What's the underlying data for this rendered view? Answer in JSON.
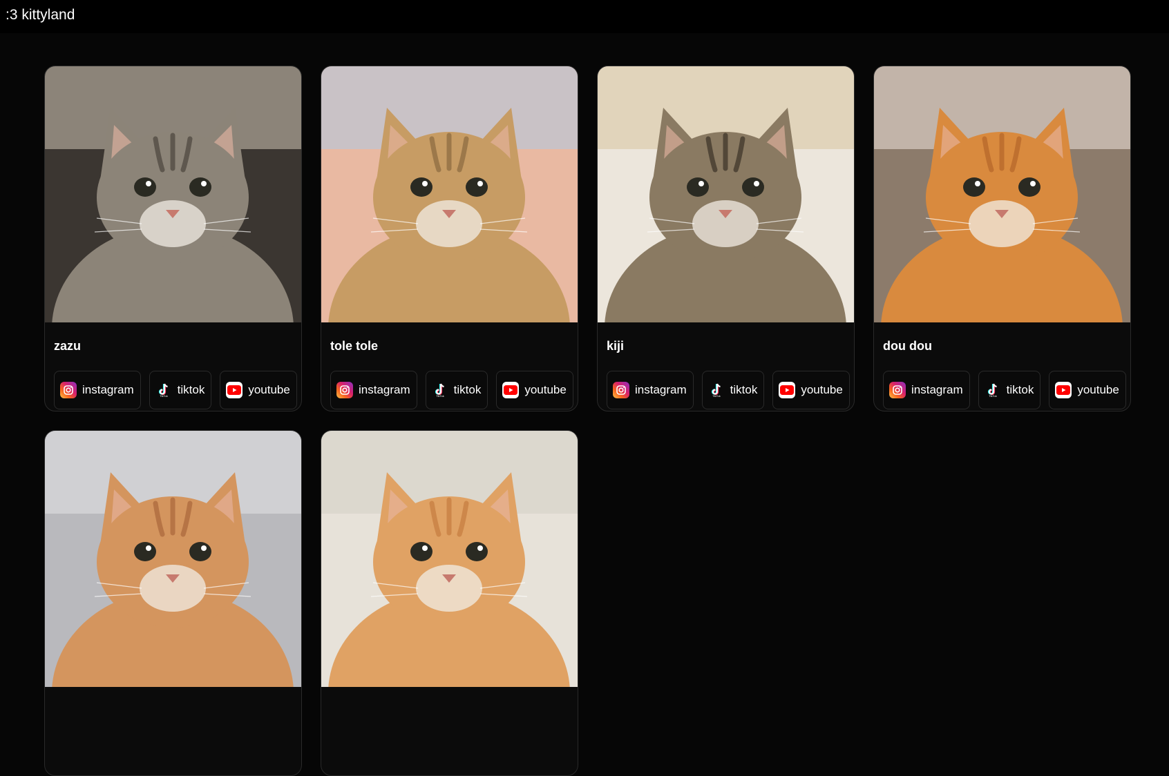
{
  "site": {
    "title": ":3 kittyland"
  },
  "cards": [
    {
      "name": "zazu",
      "photo": {
        "bg": "#3b3631",
        "fur": "#8c8478",
        "stripe": "#4a443c",
        "bg2": "#cfc5b4"
      },
      "links": [
        {
          "label": "instagram",
          "icon": "instagram-icon"
        },
        {
          "label": "tiktok",
          "icon": "tiktok-icon"
        },
        {
          "label": "youtube",
          "icon": "youtube-icon"
        }
      ]
    },
    {
      "name": "tole tole",
      "photo": {
        "bg": "#e9b9a2",
        "fur": "#c79c64",
        "stripe": "#8a6a3e",
        "bg2": "#aecbe3"
      },
      "links": [
        {
          "label": "instagram",
          "icon": "instagram-icon"
        },
        {
          "label": "tiktok",
          "icon": "tiktok-icon"
        },
        {
          "label": "youtube",
          "icon": "youtube-icon"
        }
      ]
    },
    {
      "name": "kiji",
      "photo": {
        "bg": "#ece6dc",
        "fur": "#8a7a62",
        "stripe": "#3a3226",
        "bg2": "#d9c4a0"
      },
      "links": [
        {
          "label": "instagram",
          "icon": "instagram-icon"
        },
        {
          "label": "tiktok",
          "icon": "tiktok-icon"
        },
        {
          "label": "youtube",
          "icon": "youtube-icon"
        }
      ]
    },
    {
      "name": "dou dou",
      "photo": {
        "bg": "#8c7b6b",
        "fur": "#d98a3e",
        "stripe": "#b3652a",
        "bg2": "#efe4dc"
      },
      "links": [
        {
          "label": "instagram",
          "icon": "instagram-icon"
        },
        {
          "label": "tiktok",
          "icon": "tiktok-icon"
        },
        {
          "label": "youtube",
          "icon": "youtube-icon"
        }
      ]
    },
    {
      "name": "",
      "photo": {
        "bg": "#b9b9bd",
        "fur": "#d4955e",
        "stripe": "#a9663a",
        "bg2": "#e3e3e6"
      },
      "links": []
    },
    {
      "name": "",
      "photo": {
        "bg": "#e7e2d9",
        "fur": "#e0a264",
        "stripe": "#c47c3e",
        "bg2": "#d4cfc5"
      },
      "links": []
    }
  ],
  "colors": {
    "background": "#060606",
    "card": "#0b0b0b",
    "border": "#2a2a2a",
    "youtube": "#ff0000"
  }
}
